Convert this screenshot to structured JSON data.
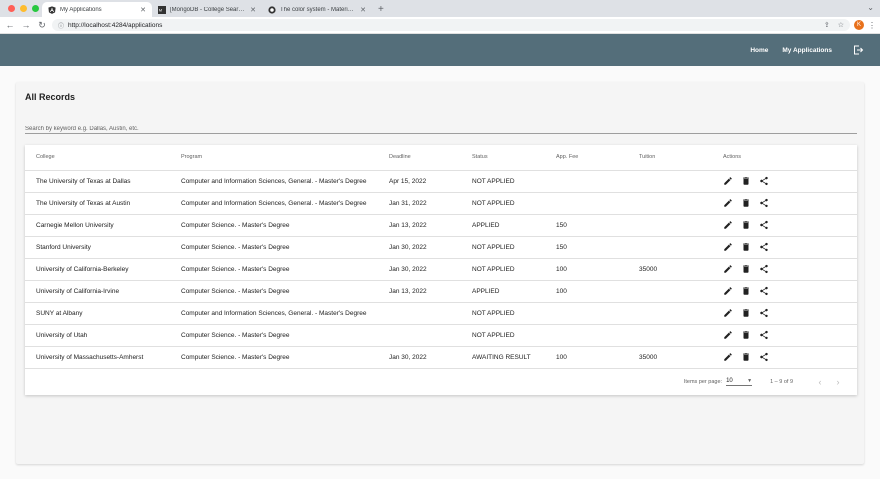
{
  "browser": {
    "tabs": [
      {
        "label": "My Applications",
        "favicon": "angular-icon",
        "active": true
      },
      {
        "label": "[MongoDB - College Search M",
        "favicon": "mongodb-icon",
        "active": false
      },
      {
        "label": "The color system - Material De",
        "favicon": "material-icon",
        "active": false
      }
    ],
    "new_tab": "+",
    "url": "http://localhost:4284/applications",
    "profile_initial": "K"
  },
  "toolbar": {
    "home": "Home",
    "my_applications": "My Applications"
  },
  "card": {
    "title": "All Records",
    "search_placeholder": "Search by keyword e.g. Dallas, Austin, etc."
  },
  "table": {
    "headers": [
      "College",
      "Program",
      "Deadline",
      "Status",
      "App. Fee",
      "Tuition",
      "Actions"
    ],
    "rows": [
      {
        "college": "The University of Texas at Dallas",
        "program": "Computer and Information Sciences, General. - Master's Degree",
        "deadline": "Apr 15, 2022",
        "status": "NOT APPLIED",
        "fee": "",
        "tuition": ""
      },
      {
        "college": "The University of Texas at Austin",
        "program": "Computer and Information Sciences, General. - Master's Degree",
        "deadline": "Jan 31, 2022",
        "status": "NOT APPLIED",
        "fee": "",
        "tuition": ""
      },
      {
        "college": "Carnegie Mellon University",
        "program": "Computer Science. - Master's Degree",
        "deadline": "Jan 13, 2022",
        "status": "APPLIED",
        "fee": "150",
        "tuition": ""
      },
      {
        "college": "Stanford University",
        "program": "Computer Science. - Master's Degree",
        "deadline": "Jan 30, 2022",
        "status": "NOT APPLIED",
        "fee": "150",
        "tuition": ""
      },
      {
        "college": "University of California-Berkeley",
        "program": "Computer Science. - Master's Degree",
        "deadline": "Jan 30, 2022",
        "status": "NOT APPLIED",
        "fee": "100",
        "tuition": "35000"
      },
      {
        "college": "University of California-Irvine",
        "program": "Computer Science. - Master's Degree",
        "deadline": "Jan 13, 2022",
        "status": "APPLIED",
        "fee": "100",
        "tuition": ""
      },
      {
        "college": "SUNY at Albany",
        "program": "Computer and Information Sciences, General. - Master's Degree",
        "deadline": "",
        "status": "NOT APPLIED",
        "fee": "",
        "tuition": ""
      },
      {
        "college": "University of Utah",
        "program": "Computer Science. - Master's Degree",
        "deadline": "",
        "status": "NOT APPLIED",
        "fee": "",
        "tuition": ""
      },
      {
        "college": "University of Massachusetts-Amherst",
        "program": "Computer Science. - Master's Degree",
        "deadline": "Jan 30, 2022",
        "status": "AWAITING RESULT",
        "fee": "100",
        "tuition": "35000"
      }
    ]
  },
  "paginator": {
    "items_per_page_label": "Items per page:",
    "items_per_page": "10",
    "range": "1 – 9 of 9"
  },
  "colors": {
    "toolbar": "#546e7a",
    "card_bg": "#f5f5f5"
  }
}
